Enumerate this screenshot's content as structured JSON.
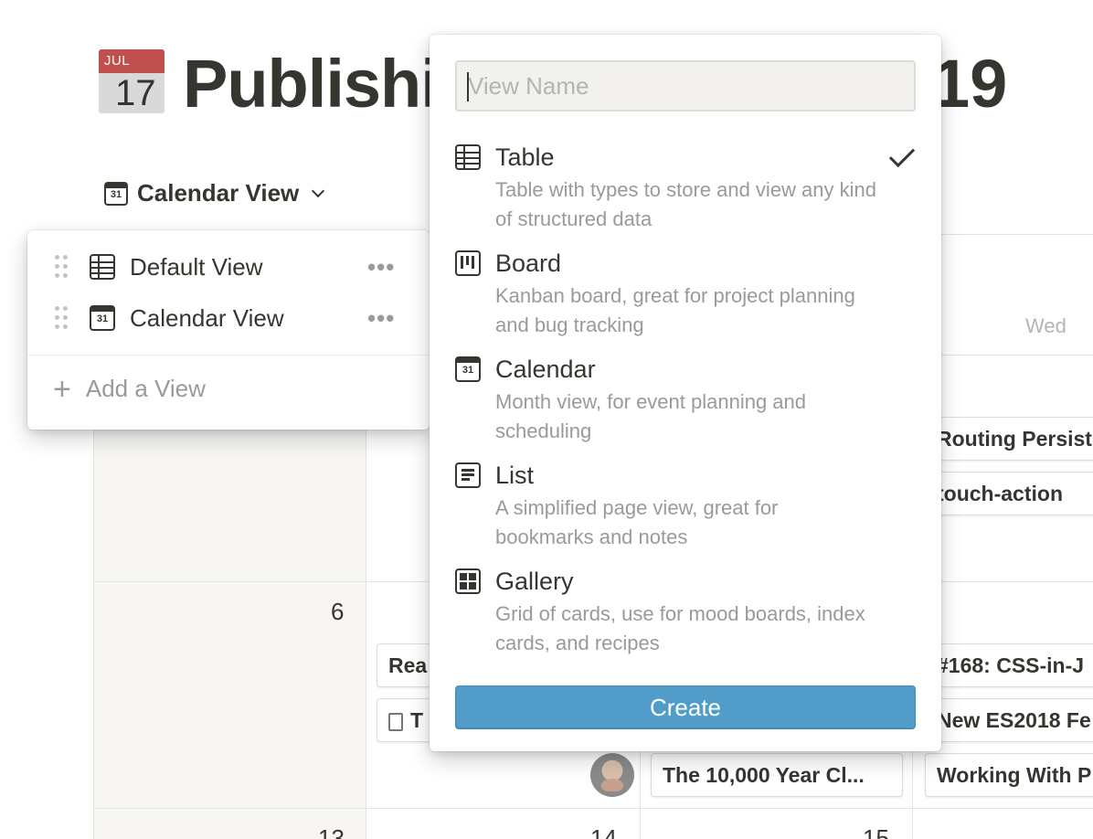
{
  "page": {
    "icon_month": "JUL",
    "icon_day": "17",
    "title_visible": "Publishi",
    "title_tail": "19"
  },
  "view_switcher": {
    "current": "Calendar View",
    "icon": "calendar-icon",
    "icon_day": "31"
  },
  "calendar": {
    "day_header_wed": "Wed",
    "day_numbers": [
      "6",
      "13",
      "14",
      "15"
    ],
    "cards": [
      "Routing Persist",
      "touch-action",
      "Rea",
      "T",
      "#168: CSS-in-J",
      "New ES2018 Fe",
      "The 10,000 Year Cl...",
      "Working With P"
    ]
  },
  "views_popup": {
    "items": [
      {
        "label": "Default View",
        "icon": "table-icon",
        "more": "•••"
      },
      {
        "label": "Calendar View",
        "icon": "calendar-icon",
        "icon_day": "31",
        "more": "•••"
      }
    ],
    "add_label": "Add a View"
  },
  "create_popup": {
    "name_placeholder": "View Name",
    "name_value": "",
    "options": [
      {
        "name": "Table",
        "desc": "Table with types to store and view any kind of structured data",
        "icon": "table-icon",
        "selected": true
      },
      {
        "name": "Board",
        "desc": "Kanban board, great for project planning and bug tracking",
        "icon": "board-icon",
        "selected": false
      },
      {
        "name": "Calendar",
        "desc": "Month view, for event planning and scheduling",
        "icon": "calendar-icon",
        "icon_day": "31",
        "selected": false
      },
      {
        "name": "List",
        "desc": "A simplified page view, great for bookmarks and notes",
        "icon": "list-icon",
        "selected": false
      },
      {
        "name": "Gallery",
        "desc": "Grid of cards, use for mood boards, index cards, and recipes",
        "icon": "gallery-icon",
        "selected": false
      }
    ],
    "create_label": "Create",
    "create_color": "#529cca"
  }
}
